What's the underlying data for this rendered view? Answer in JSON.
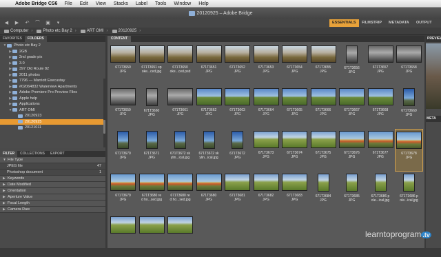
{
  "menubar": {
    "app_name": "Adobe Bridge CS6",
    "items": [
      "File",
      "Edit",
      "View",
      "Stacks",
      "Label",
      "Tools",
      "Window",
      "Help"
    ]
  },
  "window": {
    "title": "20120925 – Adobe Bridge"
  },
  "workspaces": {
    "essentials": "ESSENTIALS",
    "filmstrip": "FILMSTRIP",
    "metadata": "METADATA",
    "output": "OUTPUT"
  },
  "path": [
    "Computer",
    "Photo etc Bay 2",
    "ART OMI",
    "20120925"
  ],
  "left_tabs": {
    "favorites": "FAVORITES",
    "folders": "FOLDERS"
  },
  "tree": [
    {
      "label": "Photo etc Bay 2",
      "indent": 0,
      "arrow": "▼"
    },
    {
      "label": "2GB",
      "indent": 1,
      "arrow": "▶"
    },
    {
      "label": "2nd grade pix",
      "indent": 1,
      "arrow": "▶"
    },
    {
      "label": "3.0",
      "indent": 1,
      "arrow": "▶"
    },
    {
      "label": "397 Old Route 82",
      "indent": 1,
      "arrow": "▶"
    },
    {
      "label": "2011 photos",
      "indent": 1,
      "arrow": "▶"
    },
    {
      "label": "7796 — Marriott Execustay",
      "indent": 1,
      "arrow": "▶"
    },
    {
      "label": "#02064832 Waterview Apartments",
      "indent": 1,
      "arrow": "▶"
    },
    {
      "label": "Adobe Premiere Pro Preview Files",
      "indent": 1,
      "arrow": "▶"
    },
    {
      "label": "Apple help",
      "indent": 1,
      "arrow": "▶"
    },
    {
      "label": "Applications",
      "indent": 1,
      "arrow": "▶"
    },
    {
      "label": "ART OMI",
      "indent": 1,
      "arrow": "▼"
    },
    {
      "label": "20120923",
      "indent": 2,
      "arrow": ""
    },
    {
      "label": "20120925",
      "indent": 2,
      "arrow": "",
      "selected": true
    },
    {
      "label": "20121011",
      "indent": 2,
      "arrow": ""
    }
  ],
  "filter_tabs": {
    "filter": "FILTER",
    "collections": "COLLECTIONS",
    "export": "EXPORT"
  },
  "filters": [
    {
      "label": "File Type",
      "type": "hdr"
    },
    {
      "label": "JPEG file",
      "count": "47",
      "type": "sub"
    },
    {
      "label": "Photoshop document",
      "count": "1",
      "type": "sub"
    },
    {
      "label": "Keywords",
      "type": "hdr"
    },
    {
      "label": "Date Modified",
      "type": "hdr"
    },
    {
      "label": "Orientation",
      "type": "hdr"
    },
    {
      "label": "Aperture Value",
      "type": "hdr"
    },
    {
      "label": "Focal Length",
      "type": "hdr"
    },
    {
      "label": "Camera Raw",
      "type": "hdr"
    }
  ],
  "content_tab": "CONTENT",
  "right": {
    "preview": "PREVIEW",
    "metadata": "META"
  },
  "thumbs": [
    {
      "l1": "671T3650",
      "l2": "JPG",
      "k": "tree"
    },
    {
      "l1": "671T3651 sp",
      "l2": "oke...ced.jpg",
      "k": "tree"
    },
    {
      "l1": "671T3650",
      "l2": "oke...ced.psd",
      "k": "tree"
    },
    {
      "l1": "671T3651",
      "l2": "JPG",
      "k": "tree"
    },
    {
      "l1": "671T3652",
      "l2": "JPG",
      "k": "tree"
    },
    {
      "l1": "671T3653",
      "l2": "JPG",
      "k": "tree"
    },
    {
      "l1": "671T3654",
      "l2": "JPG",
      "k": "tree"
    },
    {
      "l1": "671T3655",
      "l2": "JPG",
      "k": "tree"
    },
    {
      "l1": "671T3656",
      "l2": "JPG",
      "k": "bw",
      "p": true
    },
    {
      "l1": "671T3657",
      "l2": "JPG",
      "k": "bw"
    },
    {
      "l1": "671T3658",
      "l2": "JPG",
      "k": "bw"
    },
    {
      "l1": "671T3659",
      "l2": "JPG",
      "k": "bw"
    },
    {
      "l1": "671T3660",
      "l2": "JPG",
      "k": "bw",
      "p": true
    },
    {
      "l1": "671T3661",
      "l2": "JPG",
      "k": "bw"
    },
    {
      "l1": "671T3662",
      "l2": "JPG",
      "k": "field"
    },
    {
      "l1": "671T3663",
      "l2": "JPG",
      "k": "field"
    },
    {
      "l1": "671T3664",
      "l2": "JPG",
      "k": "field"
    },
    {
      "l1": "671T3665",
      "l2": "JPG",
      "k": "field"
    },
    {
      "l1": "671T3666",
      "l2": "JPG",
      "k": "field"
    },
    {
      "l1": "671T3667",
      "l2": "JPG",
      "k": "field"
    },
    {
      "l1": "671T3668",
      "l2": "JPG",
      "k": "field"
    },
    {
      "l1": "671T3669",
      "l2": "JPG",
      "k": "sign",
      "p": true
    },
    {
      "l1": "671T3670",
      "l2": "JPG",
      "k": "sign",
      "p": true
    },
    {
      "l1": "671T3671",
      "l2": "JPG",
      "k": "sign",
      "p": true
    },
    {
      "l1": "671T3672 sk",
      "l2": "ylin...ical.jpg",
      "k": "sign",
      "p": true
    },
    {
      "l1": "671T3672 sk",
      "l2": "ylin...ical.jpg",
      "k": "sign",
      "p": true
    },
    {
      "l1": "671T3672",
      "l2": "JPG",
      "k": "sign",
      "p": true
    },
    {
      "l1": "671T3673",
      "l2": "JPG",
      "k": "grass"
    },
    {
      "l1": "671T3674",
      "l2": "JPG",
      "k": "grass"
    },
    {
      "l1": "671T3675",
      "l2": "JPG",
      "k": "grass"
    },
    {
      "l1": "671T3676",
      "l2": "JPG",
      "k": "trailer"
    },
    {
      "l1": "671T3677",
      "l2": "JPG",
      "k": "trailer"
    },
    {
      "l1": "671T3678",
      "l2": "JPG",
      "k": "trailer",
      "sel": true
    },
    {
      "l1": "671T3679",
      "l2": "JPG",
      "k": "trailer"
    },
    {
      "l1": "671T3680 re",
      "l2": "d ho...sed.jpg",
      "k": "trailer"
    },
    {
      "l1": "671T3680 re",
      "l2": "d ho...sed.jpg",
      "k": "trailer"
    },
    {
      "l1": "671T3680",
      "l2": "JPG",
      "k": "trailer"
    },
    {
      "l1": "671T3681",
      "l2": "JPG",
      "k": "grass"
    },
    {
      "l1": "671T3682",
      "l2": "JPG",
      "k": "grass"
    },
    {
      "l1": "671T3683",
      "l2": "JPG",
      "k": "grass"
    },
    {
      "l1": "671T3684",
      "l2": "JPG",
      "k": "grass",
      "p": true
    },
    {
      "l1": "671T3685",
      "l2": "JPG",
      "k": "grass",
      "p": true
    },
    {
      "l1": "671T3686 p",
      "l2": "ole...ical.jpg",
      "k": "grass",
      "p": true
    },
    {
      "l1": "671T3686 p",
      "l2": "ole...ical.jpg",
      "k": "grass",
      "p": true
    },
    {
      "l1": "",
      "l2": "",
      "k": "grass"
    },
    {
      "l1": "",
      "l2": "",
      "k": "grass"
    },
    {
      "l1": "",
      "l2": "",
      "k": "grass"
    }
  ],
  "watermark": {
    "text": "learntoprogram",
    "tv": ".tv"
  }
}
